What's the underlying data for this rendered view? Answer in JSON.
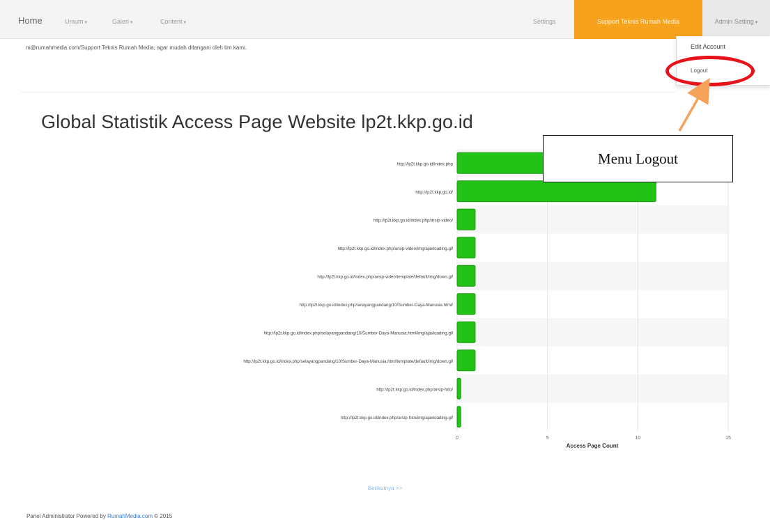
{
  "navbar": {
    "home": "Home",
    "umum": "Umum",
    "galeri": "Galeri",
    "content": "Content",
    "settings": "Settings",
    "support": "Support Teknis Rumah Media",
    "admin": "Admin Setting",
    "caret": "▾"
  },
  "dropdown": {
    "edit_account": "Edit Account",
    "logout": "Logout"
  },
  "notice": "m@rumahmedia.com/Support Teknis Rumah Media, agar mudah ditangani oleh tim kami.",
  "page_title": "Global Statistik Access Page Website lp2t.kkp.go.id",
  "callout": "Menu Logout",
  "next_link": "Berikutnya >>",
  "footer": {
    "prefix": "Panel Administrator Powered by",
    "link": "RumahMedia.com",
    "suffix": "© 2015"
  },
  "colors": {
    "bar": "#22c216",
    "support_bg": "#f6a21c",
    "highlight_ring": "#e8121a",
    "arrow": "#f5a25a"
  },
  "chart_data": {
    "type": "bar",
    "orientation": "horizontal",
    "categories": [
      "http://lp2t.kkp.go.id/index.php",
      "http://lp2t.kkp.go.id/",
      "http://lp2t.kkp.go.id/index.php/arsip-video/",
      "http://lp2t.kkp.go.id/index.php/arsip-video/img/ajaxloading.gif",
      "http://lp2t.kkp.go.id/index.php/arsip-video/template/default/img/down.gif",
      "http://lp2t.kkp.go.id/index.php/selayangpandang/10/Sumber-Daya-Manusia.html/",
      "http://lp2t.kkp.go.id/index.php/selayangpandang/10/Sumber-Daya-Manusia.html/img/ajaxloading.gif",
      "http://lp2t.kkp.go.id/index.php/selayangpandang/10/Sumber-Daya-Manusia.html/template/default/img/down.gif",
      "http://lp2t.kkp.go.id/index.php/arsip-foto/",
      "http://lp2t.kkp.go.id/index.php/arsip-foto/img/ajaxloading.gif"
    ],
    "values": [
      11,
      11,
      1,
      1,
      1,
      1,
      1,
      1,
      0.2,
      0.2
    ],
    "xlabel": "Access Page Count",
    "xlim": [
      0,
      15
    ],
    "xticks": [
      "0",
      "5",
      "10",
      "15"
    ],
    "grid": true
  }
}
